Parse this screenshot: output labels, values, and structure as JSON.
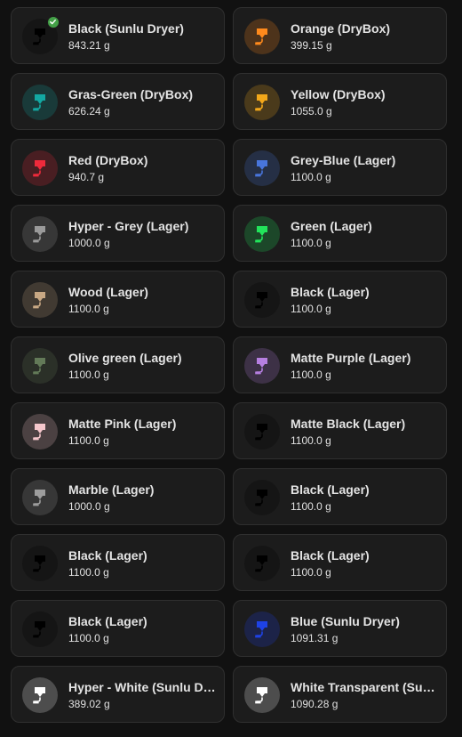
{
  "spools": [
    {
      "name": "Black (Sunlu Dryer)",
      "weight": "843.21 g",
      "color": "#000000",
      "icon": "nozzle-icon",
      "status_icon": "check-circle-icon"
    },
    {
      "name": "Orange (DryBox)",
      "weight": "399.15 g",
      "color": "#ff8a1c",
      "icon": "nozzle-icon"
    },
    {
      "name": "Gras-Green (DryBox)",
      "weight": "626.24 g",
      "color": "#13a8a2",
      "icon": "nozzle-icon"
    },
    {
      "name": "Yellow (DryBox)",
      "weight": "1055.0 g",
      "color": "#f3a81a",
      "icon": "nozzle-icon"
    },
    {
      "name": "Red (DryBox)",
      "weight": "940.7 g",
      "color": "#ee2a3b",
      "icon": "nozzle-icon"
    },
    {
      "name": "Grey-Blue (Lager)",
      "weight": "1100.0 g",
      "color": "#4875dc",
      "icon": "nozzle-icon"
    },
    {
      "name": "Hyper - Grey (Lager)",
      "weight": "1000.0 g",
      "color": "#9a9a9a",
      "icon": "nozzle-icon"
    },
    {
      "name": "Green (Lager)",
      "weight": "1100.0 g",
      "color": "#22e45b",
      "icon": "nozzle-icon"
    },
    {
      "name": "Wood (Lager)",
      "weight": "1100.0 g",
      "color": "#c8a884",
      "icon": "nozzle-icon"
    },
    {
      "name": "Black (Lager)",
      "weight": "1100.0 g",
      "color": "#000000",
      "icon": "nozzle-icon"
    },
    {
      "name": "Olive green (Lager)",
      "weight": "1100.0 g",
      "color": "#637a58",
      "icon": "nozzle-icon"
    },
    {
      "name": "Matte Purple (Lager)",
      "weight": "1100.0 g",
      "color": "#b67fe0",
      "icon": "nozzle-icon"
    },
    {
      "name": "Matte Pink (Lager)",
      "weight": "1100.0 g",
      "color": "#f5c7cc",
      "icon": "nozzle-icon"
    },
    {
      "name": "Matte Black (Lager)",
      "weight": "1100.0 g",
      "color": "#000000",
      "icon": "nozzle-icon"
    },
    {
      "name": "Marble (Lager)",
      "weight": "1000.0 g",
      "color": "#9d9d9d",
      "icon": "nozzle-icon"
    },
    {
      "name": "Black (Lager)",
      "weight": "1100.0 g",
      "color": "#000000",
      "icon": "nozzle-icon"
    },
    {
      "name": "Black (Lager)",
      "weight": "1100.0 g",
      "color": "#000000",
      "icon": "nozzle-icon"
    },
    {
      "name": "Black (Lager)",
      "weight": "1100.0 g",
      "color": "#000000",
      "icon": "nozzle-icon"
    },
    {
      "name": "Black (Lager)",
      "weight": "1100.0 g",
      "color": "#000000",
      "icon": "nozzle-icon"
    },
    {
      "name": "Blue (Sunlu Dryer)",
      "weight": "1091.31 g",
      "color": "#1e42e6",
      "icon": "nozzle-icon"
    },
    {
      "name": "Hyper - White (Sunlu Dryer)",
      "weight": "389.02 g",
      "color": "#ffffff",
      "icon": "nozzle-icon"
    },
    {
      "name": "White Transparent (Sunlu Dryer)",
      "weight": "1090.28 g",
      "color": "#ffffff",
      "icon": "nozzle-icon"
    }
  ]
}
